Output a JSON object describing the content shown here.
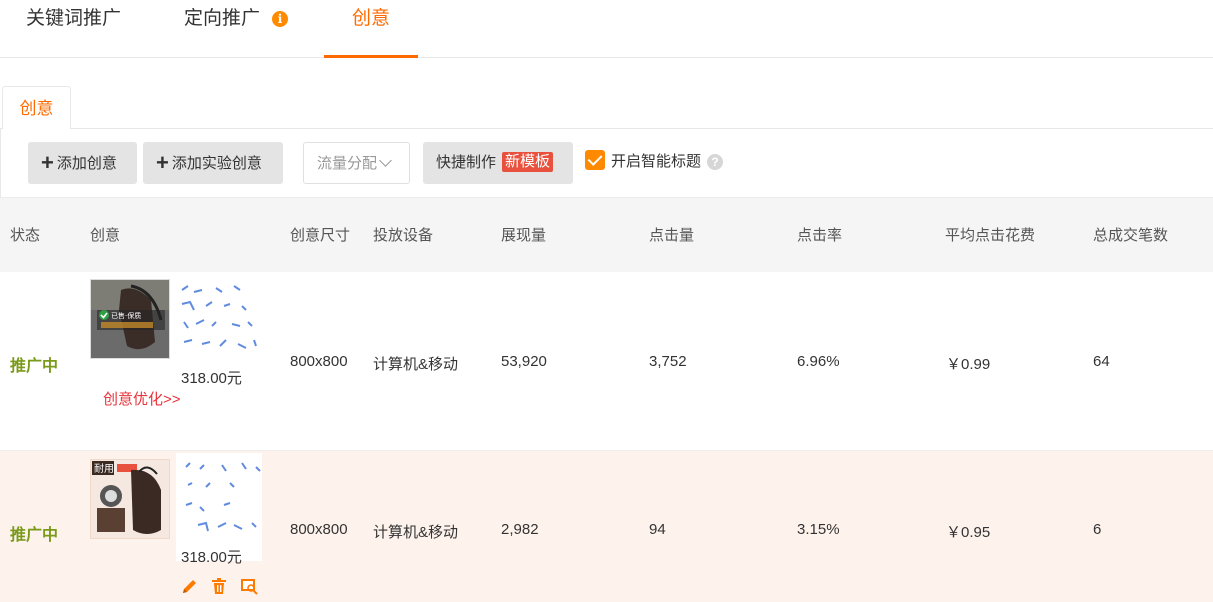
{
  "tabs": {
    "keyword": "关键词推广",
    "targeted": "定向推广",
    "targeted_info": "i",
    "creative": "创意"
  },
  "subtab": {
    "creative": "创意"
  },
  "toolbar": {
    "add_creative": "添加创意",
    "add_experiment": "添加实验创意",
    "traffic_split": "流量分配",
    "quick_make": "快捷制作",
    "new_template": "新模板",
    "smart_title": "开启智能标题",
    "smart_title_checked": true,
    "help": "?"
  },
  "table": {
    "headers": [
      "状态",
      "创意",
      "创意尺寸",
      "投放设备",
      "展现量",
      "点击量",
      "点击率",
      "平均点击花费",
      "总成交笔数"
    ],
    "rows": [
      {
        "status": "推广中",
        "thumb_caption": "已售·保质",
        "price": "318.00元",
        "optimize": "创意优化>>",
        "size": "800x800",
        "device": "计算机&移动",
        "impressions": "53,920",
        "clicks": "3,752",
        "ctr": "6.96%",
        "cpc": "￥0.99",
        "orders": "64"
      },
      {
        "status": "推广中",
        "thumb_badge": "耐用",
        "price": "318.00元",
        "size": "800x800",
        "device": "计算机&移动",
        "impressions": "2,982",
        "clicks": "94",
        "ctr": "3.15%",
        "cpc": "￥0.95",
        "orders": "6"
      }
    ]
  },
  "colors": {
    "accent": "#ff6a00",
    "status_green": "#7a9a1a",
    "badge_red": "#e8513d",
    "link_red": "#e8333c"
  }
}
